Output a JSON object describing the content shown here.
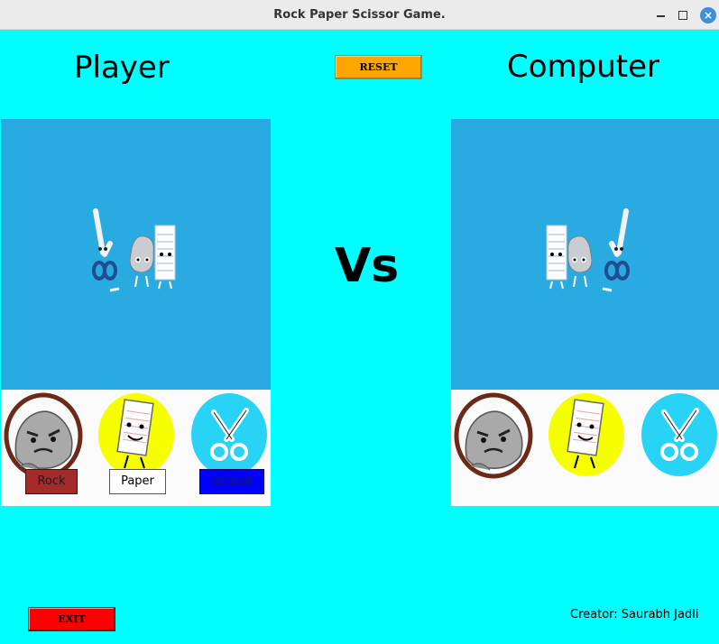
{
  "window": {
    "title": "Rock Paper Scissor Game.",
    "close_glyph": "×"
  },
  "player": {
    "heading": "Player"
  },
  "computer": {
    "heading": "Computer"
  },
  "controls": {
    "reset_label": "RESET",
    "exit_label": "EXIT"
  },
  "versus": "Vs",
  "choices": {
    "rock_label": "Rock",
    "paper_label": "Paper",
    "scissor_label": "Scissor"
  },
  "footer": {
    "creator": "Creator: Saurabh Jadli"
  },
  "colors": {
    "background": "#00ffff",
    "panel": "#29abe2",
    "reset": "#ffa500",
    "exit": "#ff0000",
    "rock_button": "#a52a2a",
    "paper_button": "#ffffff",
    "scissor_button": "#0000ff",
    "rock_ring": "#6b2a18",
    "paper_circle": "#f5ff00",
    "scissor_circle": "#29d3f5"
  },
  "icons": {
    "player_display": "rock-paper-scissors-characters-icon",
    "computer_display": "rock-paper-scissors-characters-icon",
    "rock": "rock-character-icon",
    "paper": "paper-character-icon",
    "scissor": "scissors-character-icon"
  }
}
